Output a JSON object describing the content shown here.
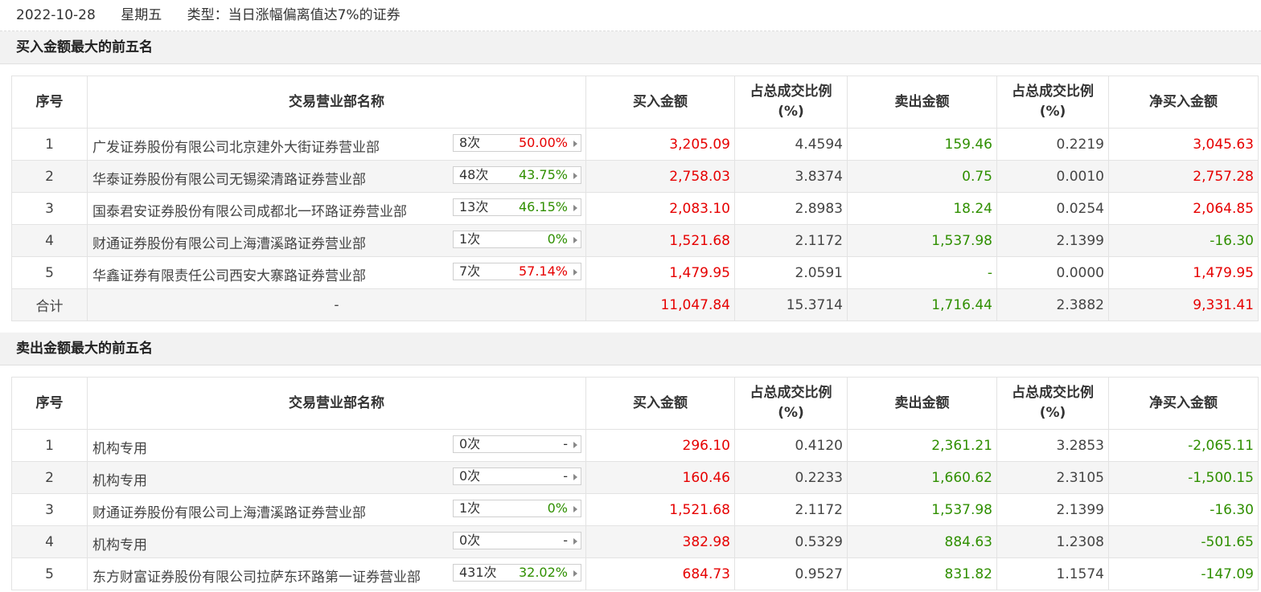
{
  "header": {
    "date": "2022-10-28",
    "weekday": "星期五",
    "type": "类型：当日涨幅偏离值达7%的证券"
  },
  "columns": [
    "序号",
    "交易营业部名称",
    "买入金额",
    "占总成交比例\n(%)",
    "卖出金额",
    "占总成交比例\n(%)",
    "净买入金额"
  ],
  "colors": {
    "up": "#e60000",
    "down": "#2f8f00"
  },
  "buy_section": {
    "title": "买入金额最大的前五名",
    "rows": [
      {
        "idx": "1",
        "name": "广发证券股份有限公司北京建外大街证券营业部",
        "times": "8次",
        "rate": "50.00%",
        "rate_color": "red",
        "buy": "3,205.09",
        "buy_pct": "4.4594",
        "sell": "159.46",
        "sell_pct": "0.2219",
        "net": "3,045.63",
        "net_color": "red"
      },
      {
        "idx": "2",
        "name": "华泰证券股份有限公司无锡梁清路证券营业部",
        "times": "48次",
        "rate": "43.75%",
        "rate_color": "green",
        "buy": "2,758.03",
        "buy_pct": "3.8374",
        "sell": "0.75",
        "sell_pct": "0.0010",
        "net": "2,757.28",
        "net_color": "red"
      },
      {
        "idx": "3",
        "name": "国泰君安证券股份有限公司成都北一环路证券营业部",
        "times": "13次",
        "rate": "46.15%",
        "rate_color": "green",
        "buy": "2,083.10",
        "buy_pct": "2.8983",
        "sell": "18.24",
        "sell_pct": "0.0254",
        "net": "2,064.85",
        "net_color": "red"
      },
      {
        "idx": "4",
        "name": "财通证券股份有限公司上海漕溪路证券营业部",
        "times": "1次",
        "rate": "0%",
        "rate_color": "green",
        "buy": "1,521.68",
        "buy_pct": "2.1172",
        "sell": "1,537.98",
        "sell_pct": "2.1399",
        "net": "-16.30",
        "net_color": "green"
      },
      {
        "idx": "5",
        "name": "华鑫证券有限责任公司西安大寨路证券营业部",
        "times": "7次",
        "rate": "57.14%",
        "rate_color": "red",
        "buy": "1,479.95",
        "buy_pct": "2.0591",
        "sell": "-",
        "sell_pct": "0.0000",
        "net": "1,479.95",
        "net_color": "red"
      }
    ],
    "total": {
      "label": "合计",
      "name": "-",
      "buy": "11,047.84",
      "buy_pct": "15.3714",
      "sell": "1,716.44",
      "sell_pct": "2.3882",
      "net": "9,331.41"
    }
  },
  "sell_section": {
    "title": "卖出金额最大的前五名",
    "rows": [
      {
        "idx": "1",
        "name": "机构专用",
        "times": "0次",
        "rate": "-",
        "rate_color": "gray",
        "buy": "296.10",
        "buy_pct": "0.4120",
        "sell": "2,361.21",
        "sell_pct": "3.2853",
        "net": "-2,065.11",
        "net_color": "green"
      },
      {
        "idx": "2",
        "name": "机构专用",
        "times": "0次",
        "rate": "-",
        "rate_color": "gray",
        "buy": "160.46",
        "buy_pct": "0.2233",
        "sell": "1,660.62",
        "sell_pct": "2.3105",
        "net": "-1,500.15",
        "net_color": "green"
      },
      {
        "idx": "3",
        "name": "财通证券股份有限公司上海漕溪路证券营业部",
        "times": "1次",
        "rate": "0%",
        "rate_color": "green",
        "buy": "1,521.68",
        "buy_pct": "2.1172",
        "sell": "1,537.98",
        "sell_pct": "2.1399",
        "net": "-16.30",
        "net_color": "green"
      },
      {
        "idx": "4",
        "name": "机构专用",
        "times": "0次",
        "rate": "-",
        "rate_color": "gray",
        "buy": "382.98",
        "buy_pct": "0.5329",
        "sell": "884.63",
        "sell_pct": "1.2308",
        "net": "-501.65",
        "net_color": "green"
      },
      {
        "idx": "5",
        "name": "东方财富证券股份有限公司拉萨东环路第一证券营业部",
        "times": "431次",
        "rate": "32.02%",
        "rate_color": "green",
        "buy": "684.73",
        "buy_pct": "0.9527",
        "sell": "831.82",
        "sell_pct": "1.1574",
        "net": "-147.09",
        "net_color": "green"
      }
    ]
  }
}
